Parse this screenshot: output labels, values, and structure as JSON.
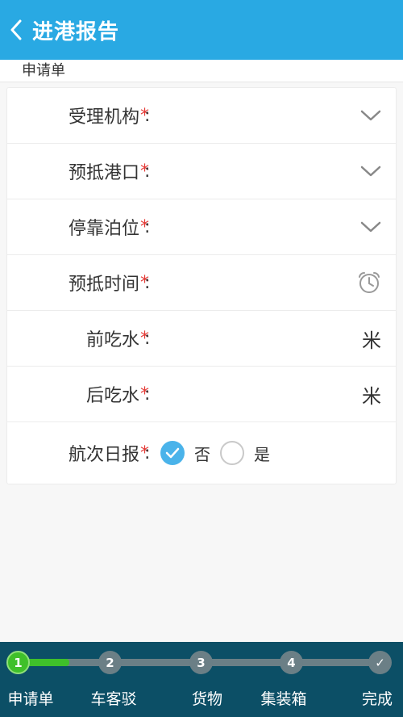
{
  "header": {
    "title": "进港报告"
  },
  "section": {
    "label": "申请单"
  },
  "form": {
    "required_mark": "*",
    "colon": ":",
    "fields": [
      {
        "label": "受理机构",
        "trailing_icon": "chevron-down-icon"
      },
      {
        "label": "预抵港口",
        "trailing_icon": "chevron-down-icon"
      },
      {
        "label": "停靠泊位",
        "trailing_icon": "chevron-down-icon"
      },
      {
        "label": "预抵时间",
        "trailing_icon": "alarm-clock-icon"
      },
      {
        "label": "前吃水",
        "unit": "米"
      },
      {
        "label": "后吃水",
        "unit": "米"
      },
      {
        "label": "航次日报",
        "options": [
          "否",
          "是"
        ],
        "selected": "否"
      }
    ]
  },
  "stepper": {
    "steps": [
      {
        "number": "1",
        "label": "申请单",
        "active": true
      },
      {
        "number": "2",
        "label": "车客驳"
      },
      {
        "number": "3",
        "label": "货物"
      },
      {
        "number": "4",
        "label": "集装箱"
      },
      {
        "number": "✓",
        "label": "完成"
      }
    ],
    "active_color": "#3fc02a",
    "inactive_color": "#6b7f86"
  },
  "colors": {
    "primary": "#29a9e3",
    "footer": "#0c4f66",
    "required": "#e53935"
  }
}
